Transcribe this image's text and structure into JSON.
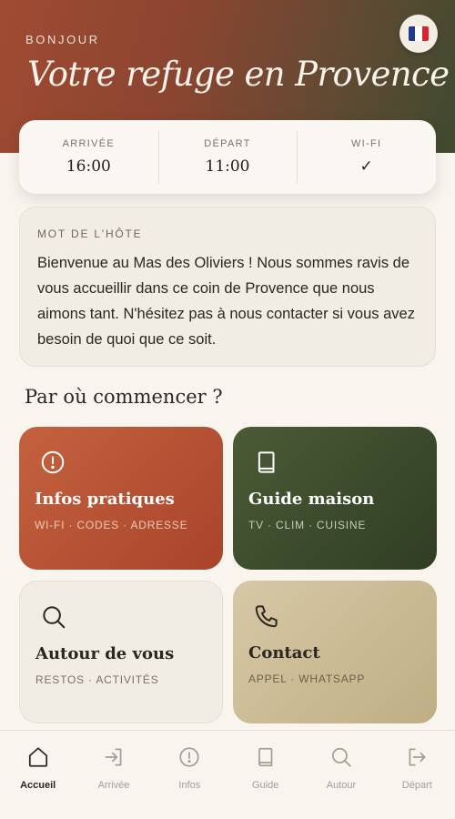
{
  "header": {
    "greeting": "BONJOUR",
    "title": "Votre refuge en Provence",
    "language_flag": "flag-france-icon"
  },
  "stay_info": [
    {
      "label": "ARRIVÉE",
      "value": "16:00"
    },
    {
      "label": "DÉPART",
      "value": "11:00"
    },
    {
      "label": "WI-FI",
      "value": "✓"
    }
  ],
  "host": {
    "label": "MOT DE L'HÔTE",
    "message": "Bienvenue au Mas des Oliviers ! Nous sommes ravis de vous accueillir dans ce coin de Provence que nous aimons tant. N'hésitez pas à nous contacter si vous avez besoin de quoi que ce soit."
  },
  "start": {
    "title": "Par où commencer ?",
    "tiles": [
      {
        "title": "Infos pratiques",
        "subtitle": "WI-FI · CODES · ADRESSE",
        "icon": "alert-circle-icon"
      },
      {
        "title": "Guide maison",
        "subtitle": "TV · CLIM · CUISINE",
        "icon": "book-icon"
      },
      {
        "title": "Autour de vous",
        "subtitle": "RESTOS · ACTIVITÉS",
        "icon": "search-icon"
      },
      {
        "title": "Contact",
        "subtitle": "APPEL · WHATSAPP",
        "icon": "phone-icon"
      }
    ]
  },
  "nav": {
    "active": "Accueil",
    "items": [
      {
        "label": "Accueil",
        "icon": "home-icon"
      },
      {
        "label": "Arrivée",
        "icon": "login-icon"
      },
      {
        "label": "Infos",
        "icon": "alert-circle-icon"
      },
      {
        "label": "Guide",
        "icon": "book-icon"
      },
      {
        "label": "Autour",
        "icon": "search-icon"
      },
      {
        "label": "Départ",
        "icon": "logout-icon"
      }
    ]
  },
  "colors": {
    "terracotta": "#b5543a",
    "olive": "#3f4d2c",
    "sand": "#cbbb94",
    "cream": "#f8f5ef"
  }
}
